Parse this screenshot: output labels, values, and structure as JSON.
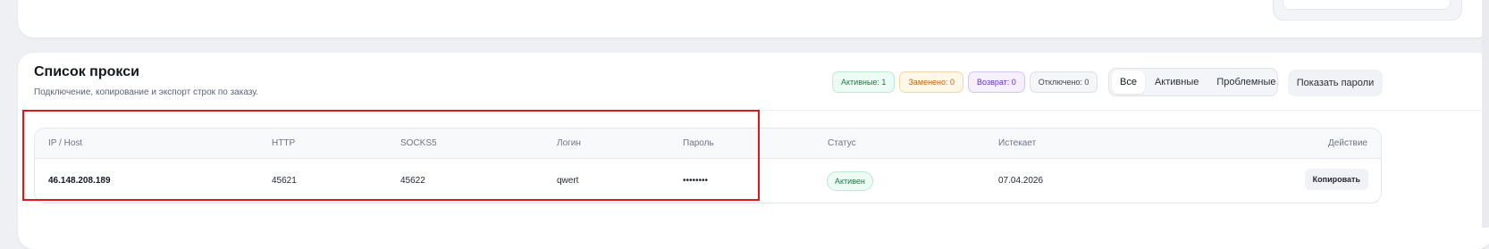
{
  "section": {
    "title": "Список прокси",
    "subtitle": "Подключение, копирование и экспорт строк по заказу."
  },
  "badges": {
    "active": "Активные: 1",
    "replaced": "Заменено: 0",
    "returned": "Возврат: 0",
    "disabled": "Отключено: 0"
  },
  "filter": {
    "all": "Все",
    "active": "Активные",
    "problem": "Проблемные",
    "selected": "Все"
  },
  "show_passwords_label": "Показать пароли",
  "table": {
    "headers": {
      "ip": "IP / Host",
      "http": "HTTP",
      "socks5": "SOCKS5",
      "login": "Логин",
      "password": "Пароль",
      "status": "Статус",
      "expires": "Истекает",
      "action": "Действие"
    },
    "rows": [
      {
        "ip": "46.148.208.189",
        "http": "45621",
        "socks5": "45622",
        "login": "qwert",
        "password": "••••••••",
        "status": "Активен",
        "expires": "07.04.2026",
        "action": "Копировать"
      }
    ]
  },
  "colors": {
    "highlight": "#e0161c",
    "active_green": "#1f7a47"
  }
}
